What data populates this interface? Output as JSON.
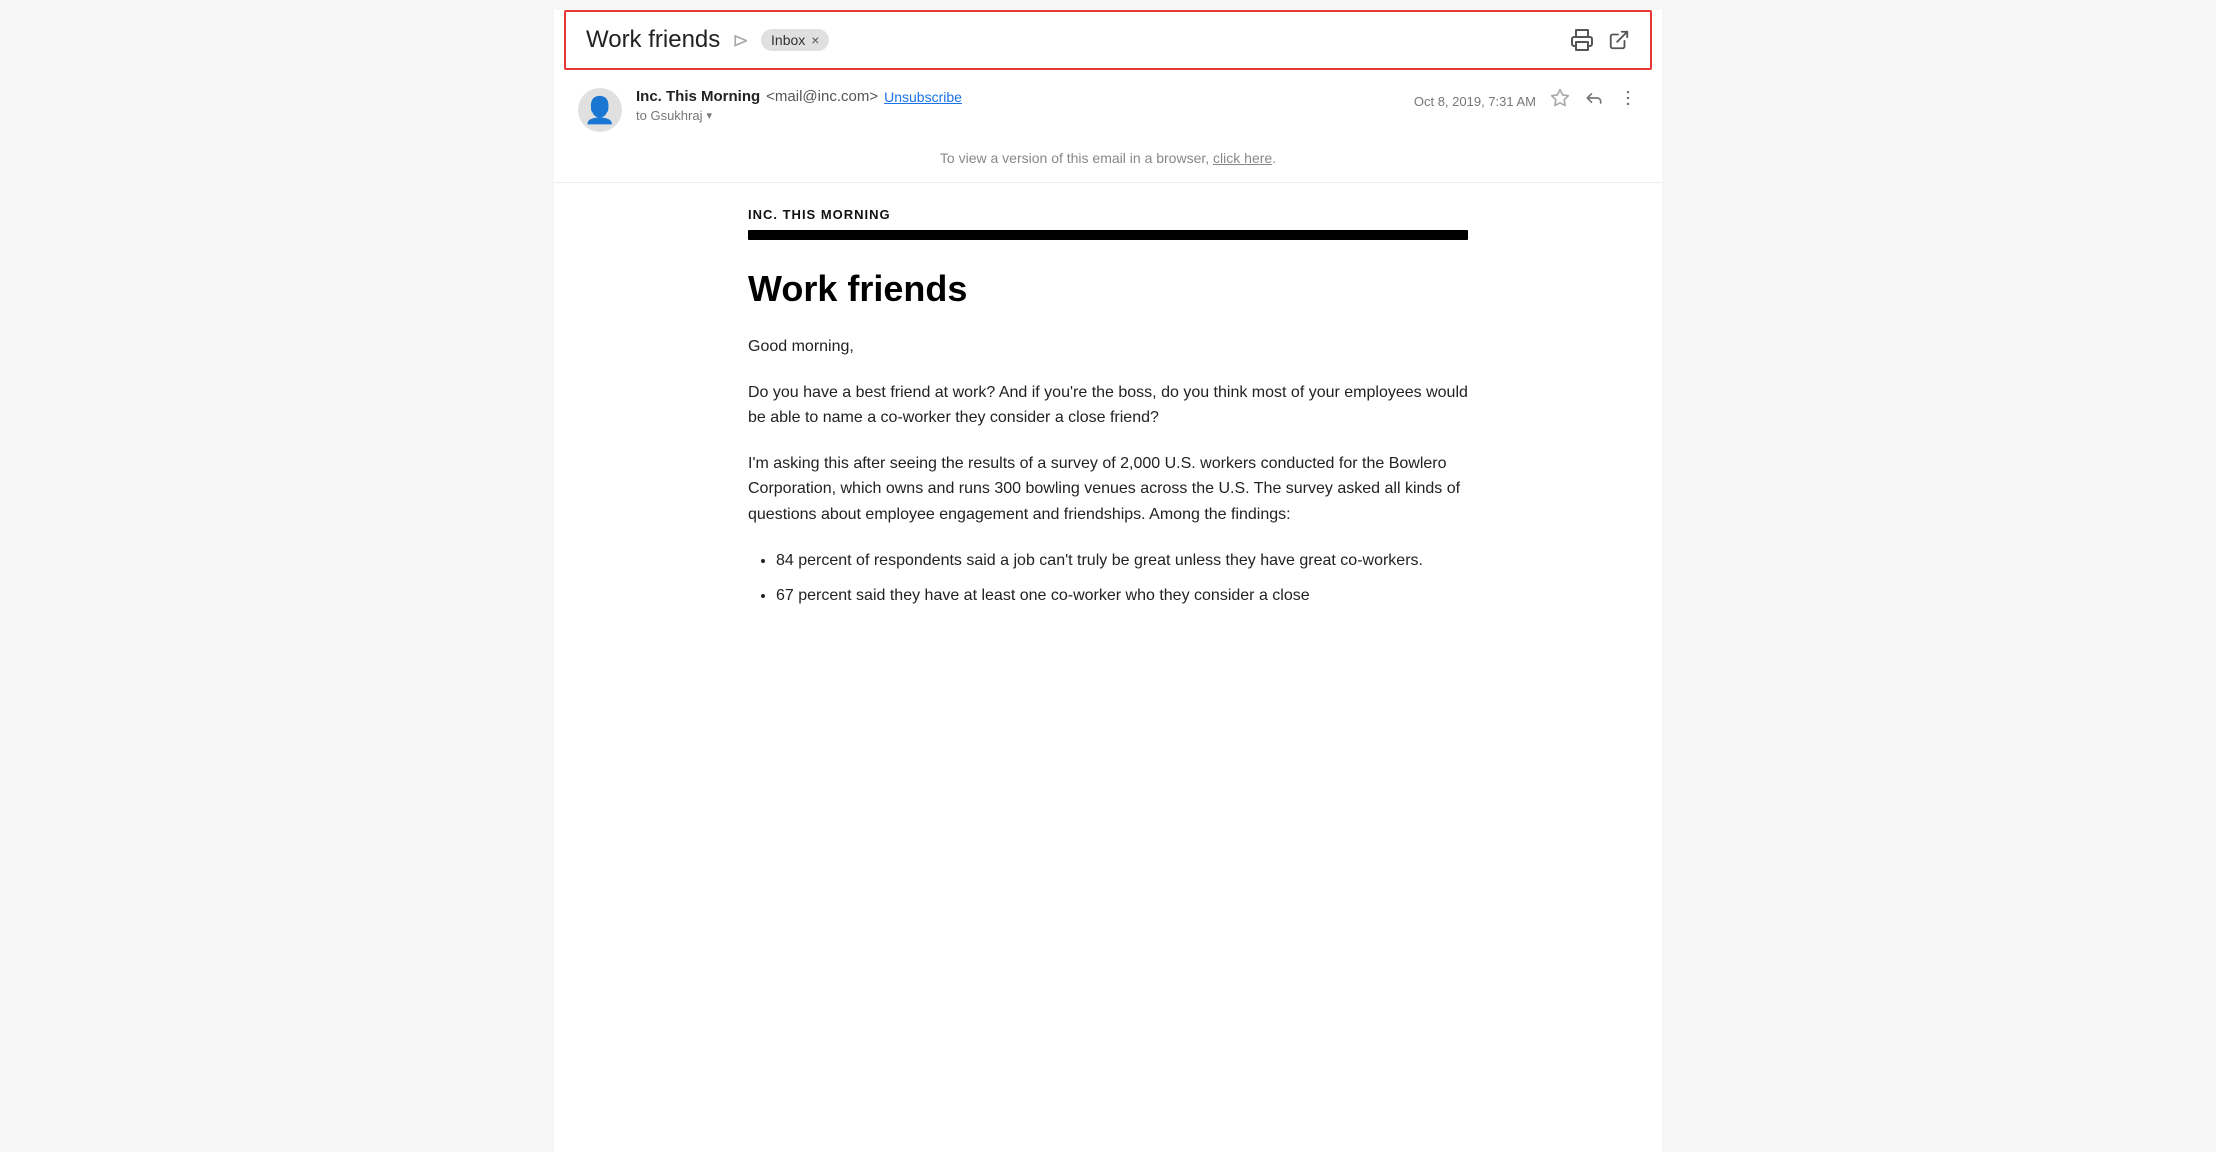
{
  "subject": {
    "title": "Work friends",
    "arrow": "⊳",
    "inbox_label": "Inbox",
    "inbox_close": "×"
  },
  "toolbar_right": {
    "print_icon": "🖨",
    "open_icon": "⧉"
  },
  "sender": {
    "name": "Inc. This Morning",
    "email": "<mail@inc.com>",
    "unsubscribe": "Unsubscribe",
    "to_label": "to Gsukhraj",
    "date": "Oct 8, 2019, 7:31 AM"
  },
  "browser_notice": {
    "text": "To view a version of this email in a browser,",
    "link_text": "click here",
    "suffix": "."
  },
  "email_body": {
    "brand": "INC. THIS MORNING",
    "headline": "Work friends",
    "greeting": "Good morning,",
    "paragraph1": "Do you have a best friend at work? And if you're the boss, do you think most of your employees would be able to name a co-worker they consider a close friend?",
    "paragraph2": "I'm asking this after seeing the results of a survey of 2,000 U.S. workers conducted for the Bowlero Corporation, which owns and runs 300 bowling venues across the U.S. The survey asked all kinds of questions about employee engagement and friendships. Among the findings:",
    "bullet1": "84 percent of respondents said a job can't truly be great unless they have great co-workers.",
    "bullet2": "67 percent said they have at least one co-worker who they consider a close"
  }
}
